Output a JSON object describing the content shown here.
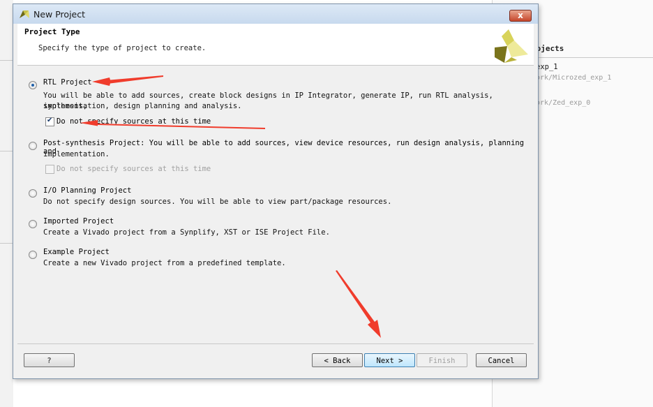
{
  "background_window": {
    "projects_heading": "rojects",
    "recent": [
      {
        "name": "exp_1",
        "path": "ork/Microzed_exp_1"
      },
      {
        "name": "",
        "path": "ork/Zed_exp_0"
      }
    ]
  },
  "dialog": {
    "title": "New Project",
    "close_label": "x",
    "header": {
      "title": "Project Type",
      "subtitle": "Specify the type of project to create."
    },
    "options": [
      {
        "title": "RTL Project",
        "description_lines": [
          "You will be able to add sources, create block designs in IP Integrator, generate IP, run RTL analysis, synthesis,",
          "implementation, design planning and analysis."
        ],
        "selected": true,
        "checkbox": {
          "label": "Do not specify sources at this time",
          "checked": true,
          "enabled": true
        }
      },
      {
        "title": "Post-synthesis Project: You will be able to add sources, view device resources, run design analysis, planning and",
        "description_lines": [
          "implementation."
        ],
        "selected": false,
        "checkbox": {
          "label": "Do not specify sources at this time",
          "checked": false,
          "enabled": false
        }
      },
      {
        "title": "I/O Planning Project",
        "description_lines": [
          "Do not specify design sources. You will be able to view part/package resources."
        ],
        "selected": false
      },
      {
        "title": "Imported Project",
        "description_lines": [
          "Create a Vivado project from a Synplify, XST or ISE Project File."
        ],
        "selected": false
      },
      {
        "title": "Example Project",
        "description_lines": [
          "Create a new Vivado project from a predefined template."
        ],
        "selected": false
      }
    ],
    "buttons": {
      "help": "?",
      "back": "< Back",
      "next": "Next >",
      "finish": "Finish",
      "cancel": "Cancel"
    }
  },
  "colors": {
    "annotation_arrow": "#f03c2c",
    "selection_accent": "#1f5fa8"
  }
}
